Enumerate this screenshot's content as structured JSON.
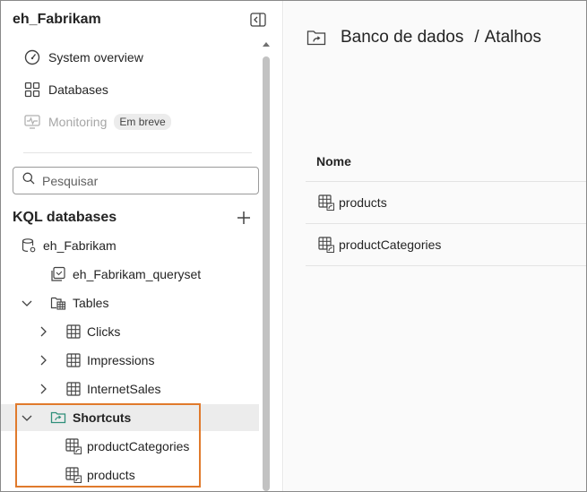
{
  "sidebar": {
    "workspace_title": "eh_Fabrikam",
    "nav": [
      {
        "label": "System overview",
        "icon": "gauge-icon"
      },
      {
        "label": "Databases",
        "icon": "grid-icon"
      },
      {
        "label": "Monitoring",
        "icon": "pulse-icon",
        "badge": "Em breve",
        "disabled": true
      }
    ],
    "search": {
      "placeholder": "Pesquisar"
    },
    "section_title": "KQL databases",
    "tree": [
      {
        "label": "eh_Fabrikam",
        "icon": "database-icon"
      },
      {
        "label": "eh_Fabrikam_queryset",
        "icon": "queryset-icon"
      },
      {
        "label": "Tables",
        "icon": "folder-table-icon",
        "expanded": true
      },
      {
        "label": "Clicks",
        "icon": "table-icon",
        "expanded": false
      },
      {
        "label": "Impressions",
        "icon": "table-icon",
        "expanded": false
      },
      {
        "label": "InternetSales",
        "icon": "table-icon",
        "expanded": false
      },
      {
        "label": "Shortcuts",
        "icon": "folder-shortcut-icon",
        "expanded": true,
        "selected": true
      },
      {
        "label": "productCategories",
        "icon": "table-shortcut-icon"
      },
      {
        "label": "products",
        "icon": "table-shortcut-icon"
      }
    ]
  },
  "main": {
    "breadcrumb": {
      "parent": "Banco de dados",
      "separator": "/",
      "current": "Atalhos"
    },
    "table": {
      "header": "Nome",
      "rows": [
        {
          "name": "products",
          "icon": "table-shortcut-icon"
        },
        {
          "name": "productCategories",
          "icon": "table-shortcut-icon"
        }
      ]
    }
  },
  "colors": {
    "highlight": "#e07a2c",
    "selected_row": "#ececec",
    "shortcut_folder": "#2f8f7a"
  }
}
